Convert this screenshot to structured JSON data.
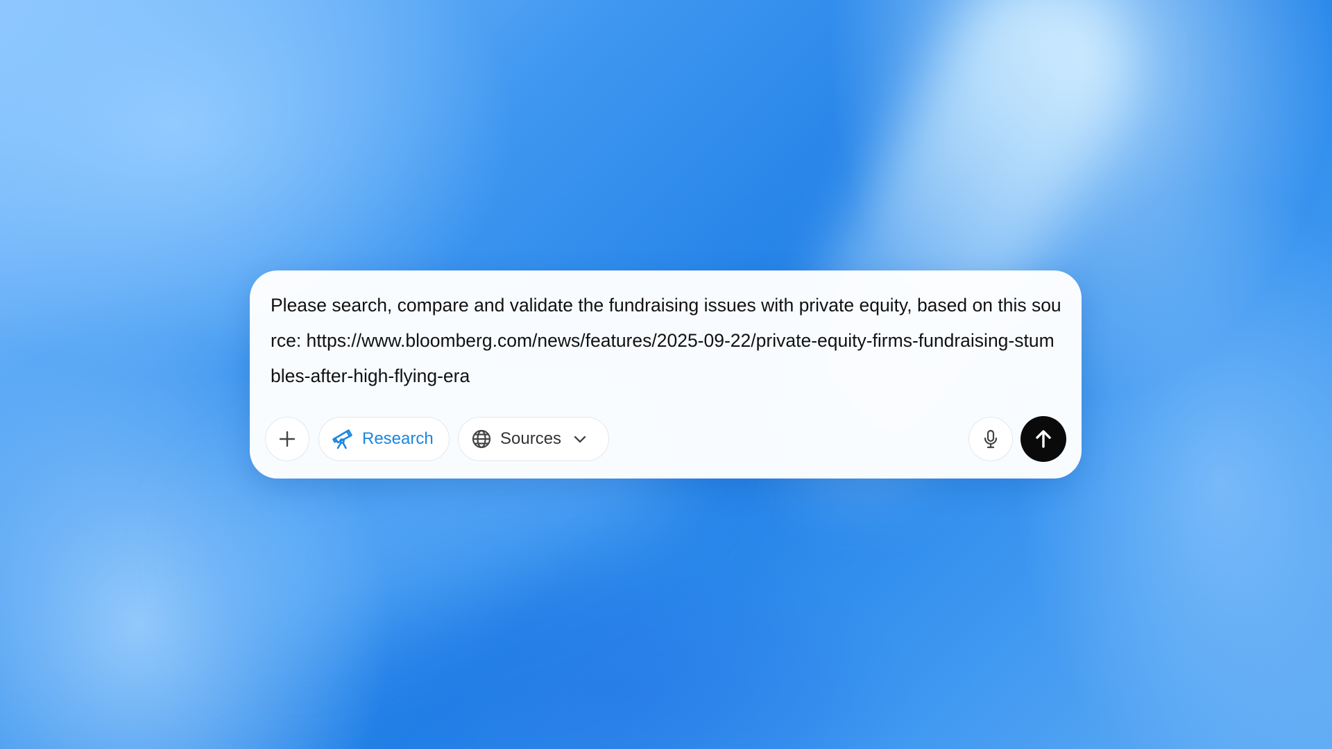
{
  "composer": {
    "prompt_text": "Please search, compare and validate the fundraising issues with private equity, based on this source: https://www.bloomberg.com/news/features/2025-09-22/private-equity-firms-fundraising-stumbles-after-high-flying-era"
  },
  "toolbar": {
    "add_icon": "plus-icon",
    "research": {
      "label": "Research",
      "icon": "telescope-icon",
      "color": "#1a86e0"
    },
    "sources": {
      "label": "Sources",
      "icon": "globe-icon",
      "dropdown_icon": "chevron-down-icon"
    },
    "mic_icon": "microphone-icon",
    "send_icon": "arrow-up-icon"
  },
  "colors": {
    "background_accent": "#1f7fe6",
    "composer_bg": "#ffffff",
    "send_button_bg": "#0a0a0a",
    "research_accent": "#1a86e0"
  }
}
